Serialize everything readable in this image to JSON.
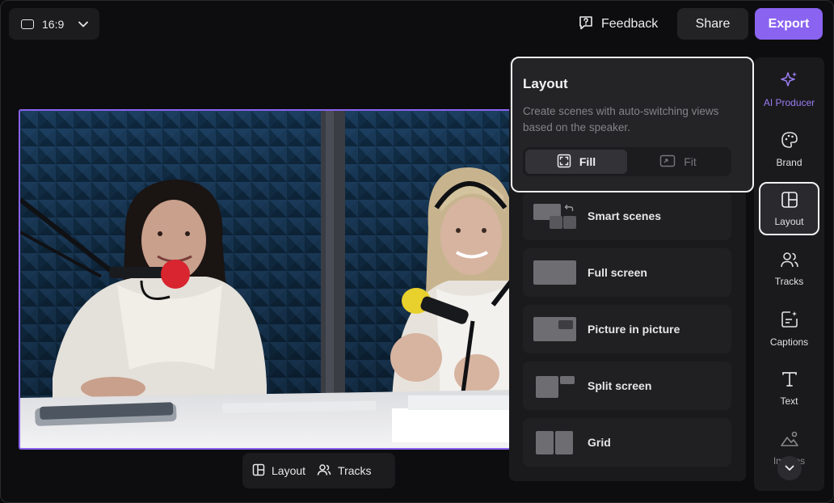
{
  "topbar": {
    "aspect_ratio": "16:9",
    "feedback_label": "Feedback",
    "share_label": "Share",
    "export_label": "Export"
  },
  "bottom_pill": {
    "layout_label": "Layout",
    "tracks_label": "Tracks"
  },
  "layout_card": {
    "title": "Layout",
    "description": "Create scenes with auto-switching views based on the speaker.",
    "fill_label": "Fill",
    "fit_label": "Fit",
    "selected": "Fill"
  },
  "layout_options": [
    {
      "label": "Smart scenes",
      "icon": "smart-scenes-thumb"
    },
    {
      "label": "Full screen",
      "icon": "full-screen-thumb"
    },
    {
      "label": "Picture in picture",
      "icon": "pip-thumb"
    },
    {
      "label": "Split screen",
      "icon": "split-thumb"
    },
    {
      "label": "Grid",
      "icon": "grid-thumb"
    }
  ],
  "sidebar": {
    "items": [
      {
        "label": "AI Producer",
        "icon": "sparkles-icon"
      },
      {
        "label": "Brand",
        "icon": "palette-icon"
      },
      {
        "label": "Layout",
        "icon": "layout-icon"
      },
      {
        "label": "Tracks",
        "icon": "people-icon"
      },
      {
        "label": "Captions",
        "icon": "captions-icon"
      },
      {
        "label": "Text",
        "icon": "text-icon"
      },
      {
        "label": "Images",
        "icon": "image-icon"
      }
    ],
    "selected": "Layout"
  },
  "colors": {
    "accent": "#8a63f0",
    "background": "#0d0d0f",
    "panel": "#1a1a1d"
  }
}
